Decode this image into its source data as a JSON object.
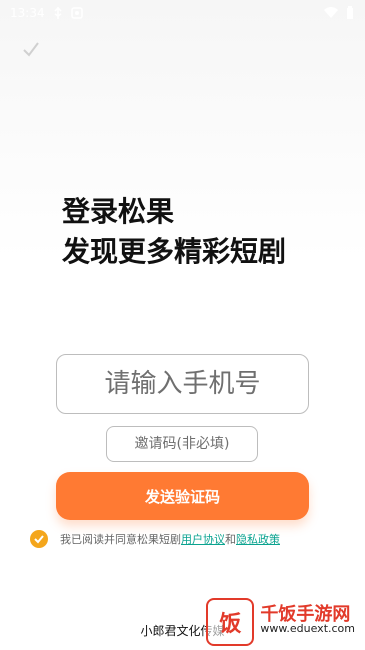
{
  "status_bar": {
    "time": "13:34",
    "icons": [
      "usb-icon",
      "notification-icon",
      "wifi-icon",
      "battery-icon"
    ]
  },
  "nav": {
    "back_icon": "check-icon"
  },
  "headline": {
    "line1": "登录松果",
    "line2": "发现更多精彩短剧"
  },
  "form": {
    "phone_placeholder": "请输入手机号",
    "invite_placeholder": "邀请码(非必填)",
    "send_button_label": "发送验证码"
  },
  "agreement": {
    "text_prefix": "我已阅读并同意松果短剧",
    "user_agreement": "用户协议",
    "and_text": "和",
    "privacy_policy": "隐私政策",
    "checked": true
  },
  "footer": {
    "company": "小郎君文化传媒"
  },
  "watermark": {
    "glyph": "饭",
    "title": "千饭手游网",
    "url": "www.eduext.com"
  },
  "colors": {
    "accent": "#ff7a33",
    "check": "#f4a61c",
    "link": "#0aa38f"
  }
}
